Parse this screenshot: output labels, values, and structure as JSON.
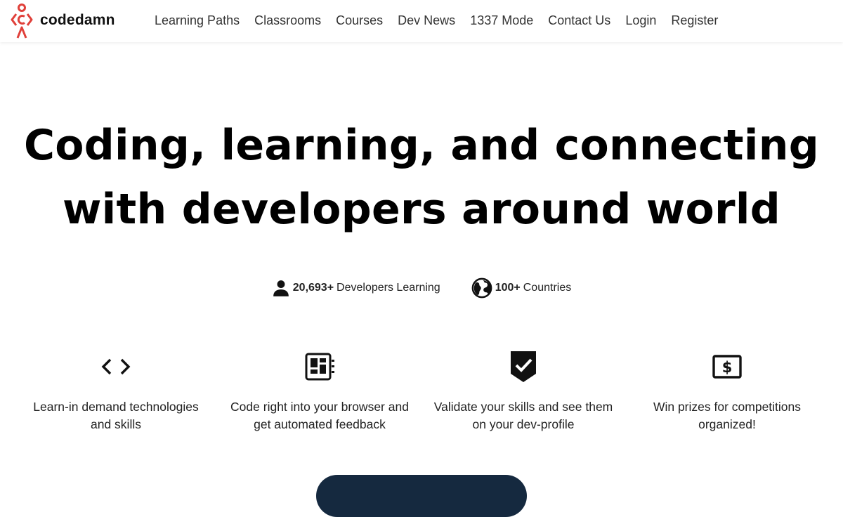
{
  "nav": {
    "brand": "codedamn",
    "items": [
      {
        "label": "Learning Paths"
      },
      {
        "label": "Classrooms"
      },
      {
        "label": "Courses"
      },
      {
        "label": "Dev News"
      },
      {
        "label": "1337 Mode"
      },
      {
        "label": "Contact Us"
      },
      {
        "label": "Login"
      },
      {
        "label": "Register"
      }
    ]
  },
  "hero": {
    "line1": "Coding, learning, and connecting",
    "line2": "with developers around world"
  },
  "stats": [
    {
      "value": "20,693+",
      "label": "Developers Learning",
      "icon": "user-icon"
    },
    {
      "value": "100+",
      "label": "Countries",
      "icon": "globe-icon"
    }
  ],
  "features": [
    {
      "icon": "code-brackets-icon",
      "text": "Learn-in demand technologies and skills"
    },
    {
      "icon": "browser-editor-icon",
      "text": "Code right into your browser and get automated feedback"
    },
    {
      "icon": "verified-shield-icon",
      "text": "Validate your skills and see them on your dev-profile"
    },
    {
      "icon": "dollar-prize-icon",
      "text": "Win prizes for competitions organized!"
    }
  ],
  "colors": {
    "logo_red": "#e0403a",
    "cta_bg": "#15293f"
  }
}
